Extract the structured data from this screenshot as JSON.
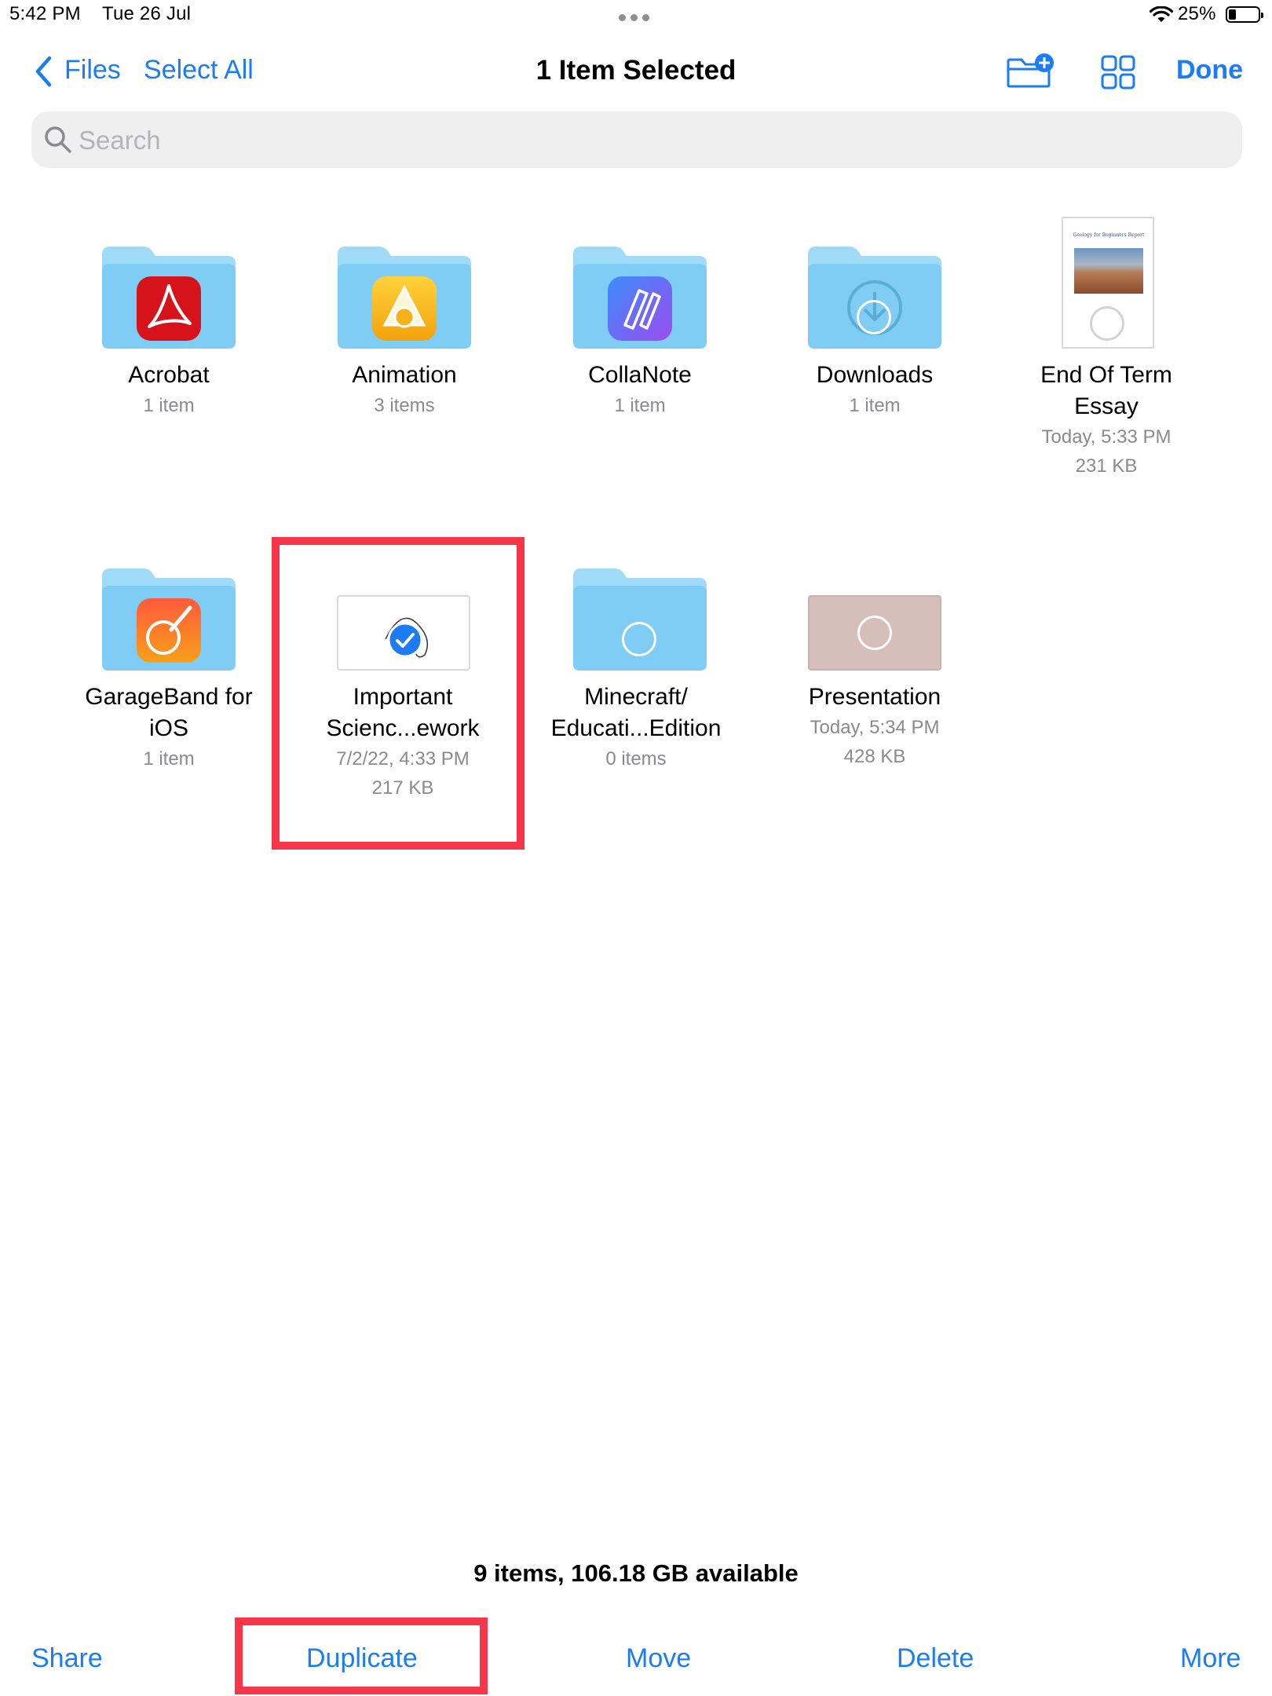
{
  "status_bar": {
    "time": "5:42 PM",
    "date": "Tue 26 Jul",
    "battery": "25%",
    "battery_level": 0.25,
    "wifi_icon": "wifi-icon"
  },
  "nav": {
    "back_label": "Files",
    "select_all": "Select All",
    "title": "1 Item Selected",
    "done": "Done"
  },
  "search": {
    "placeholder": "Search"
  },
  "items": [
    {
      "name": "Acrobat",
      "meta": [
        "1 item"
      ],
      "type": "folder",
      "app_icon": "acrobat-icon"
    },
    {
      "name": "Animation",
      "meta": [
        "3 items"
      ],
      "type": "folder",
      "app_icon": "animation-app-icon"
    },
    {
      "name": "CollaNote",
      "meta": [
        "1 item"
      ],
      "type": "folder",
      "app_icon": "collanote-icon"
    },
    {
      "name": "Downloads",
      "meta": [
        "1 item"
      ],
      "type": "folder",
      "app_icon": "download-icon"
    },
    {
      "name_lines": [
        "End Of Term",
        "Essay"
      ],
      "meta": [
        "Today, 5:33 PM",
        "231 KB"
      ],
      "type": "document",
      "thumb_title": "Geology for Beginners Report"
    },
    {
      "name_lines": [
        "GarageBand for",
        "iOS"
      ],
      "meta": [
        "1 item"
      ],
      "type": "folder",
      "app_icon": "garageband-icon"
    },
    {
      "name_lines": [
        "Important",
        "Scienc...ework"
      ],
      "meta": [
        "7/2/22, 4:33 PM",
        "217 KB"
      ],
      "type": "document",
      "selected": true
    },
    {
      "name_lines": [
        "Minecraft/",
        "Educati...Edition"
      ],
      "meta": [
        "0 items"
      ],
      "type": "folder"
    },
    {
      "name": "Presentation",
      "meta": [
        "Today, 5:34 PM",
        "428 KB"
      ],
      "type": "presentation"
    }
  ],
  "footer": {
    "info": "9 items, 106.18 GB available"
  },
  "toolbar": {
    "share": "Share",
    "duplicate": "Duplicate",
    "move": "Move",
    "delete": "Delete",
    "more": "More"
  },
  "colors": {
    "accent": "#1b7cf3",
    "folder": "#7fcdf5",
    "folder_tab": "#9fdaf7",
    "highlight": "#f8364a",
    "presentation_thumb": "#d6bfba"
  }
}
